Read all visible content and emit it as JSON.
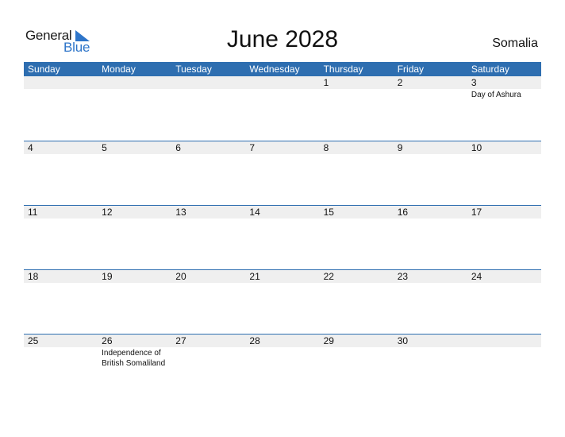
{
  "logo": {
    "word1": "General",
    "word2": "Blue",
    "accent_color": "#2e75c9"
  },
  "header": {
    "title": "June 2028",
    "country": "Somalia"
  },
  "colors": {
    "header_bg": "#2e6eb0",
    "date_strip_bg": "#efefef"
  },
  "weekdays": [
    "Sunday",
    "Monday",
    "Tuesday",
    "Wednesday",
    "Thursday",
    "Friday",
    "Saturday"
  ],
  "weeks": [
    [
      {
        "day": ""
      },
      {
        "day": ""
      },
      {
        "day": ""
      },
      {
        "day": ""
      },
      {
        "day": "1"
      },
      {
        "day": "2"
      },
      {
        "day": "3",
        "event": "Day of Ashura"
      }
    ],
    [
      {
        "day": "4"
      },
      {
        "day": "5"
      },
      {
        "day": "6"
      },
      {
        "day": "7"
      },
      {
        "day": "8"
      },
      {
        "day": "9"
      },
      {
        "day": "10"
      }
    ],
    [
      {
        "day": "11"
      },
      {
        "day": "12"
      },
      {
        "day": "13"
      },
      {
        "day": "14"
      },
      {
        "day": "15"
      },
      {
        "day": "16"
      },
      {
        "day": "17"
      }
    ],
    [
      {
        "day": "18"
      },
      {
        "day": "19"
      },
      {
        "day": "20"
      },
      {
        "day": "21"
      },
      {
        "day": "22"
      },
      {
        "day": "23"
      },
      {
        "day": "24"
      }
    ],
    [
      {
        "day": "25"
      },
      {
        "day": "26",
        "event": "Independence of British Somaliland"
      },
      {
        "day": "27"
      },
      {
        "day": "28"
      },
      {
        "day": "29"
      },
      {
        "day": "30"
      },
      {
        "day": ""
      }
    ]
  ]
}
